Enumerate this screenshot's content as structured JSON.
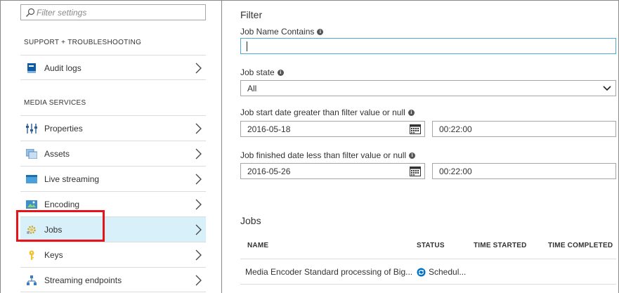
{
  "left": {
    "filter_placeholder": "Filter settings",
    "sections": [
      {
        "title": "SUPPORT + TROUBLESHOOTING",
        "items": [
          {
            "label": "Audit logs",
            "icon": "book-icon"
          }
        ]
      },
      {
        "title": "MEDIA SERVICES",
        "items": [
          {
            "label": "Properties",
            "icon": "properties-icon"
          },
          {
            "label": "Assets",
            "icon": "assets-icon"
          },
          {
            "label": "Live streaming",
            "icon": "live-streaming-icon"
          },
          {
            "label": "Encoding",
            "icon": "encoding-icon"
          },
          {
            "label": "Jobs",
            "icon": "jobs-gear-icon",
            "selected": true
          },
          {
            "label": "Keys",
            "icon": "key-icon"
          },
          {
            "label": "Streaming endpoints",
            "icon": "network-icon"
          }
        ]
      }
    ]
  },
  "right": {
    "title": "Filter",
    "job_name_label": "Job Name Contains",
    "job_name_value": "",
    "job_state_label": "Job state",
    "job_state_value": "All",
    "start_label": "Job start date greater than filter value or null",
    "start_date": "2016-05-18",
    "start_time": "00:22:00",
    "finish_label": "Job finished date less than filter value or null",
    "finish_date": "2016-05-26",
    "finish_time": "00:22:00",
    "jobs_title": "Jobs",
    "columns": [
      "NAME",
      "STATUS",
      "TIME STARTED",
      "TIME COMPLETED"
    ],
    "rows": [
      {
        "name": "Media Encoder Standard processing of Big...",
        "status": "Schedul...",
        "time_started": "",
        "time_completed": ""
      }
    ]
  },
  "colors": {
    "selected_bg": "#d8f0fa",
    "highlight": "#e3151a",
    "focus_border": "#4ea9d6",
    "accent": "#0072c6"
  }
}
